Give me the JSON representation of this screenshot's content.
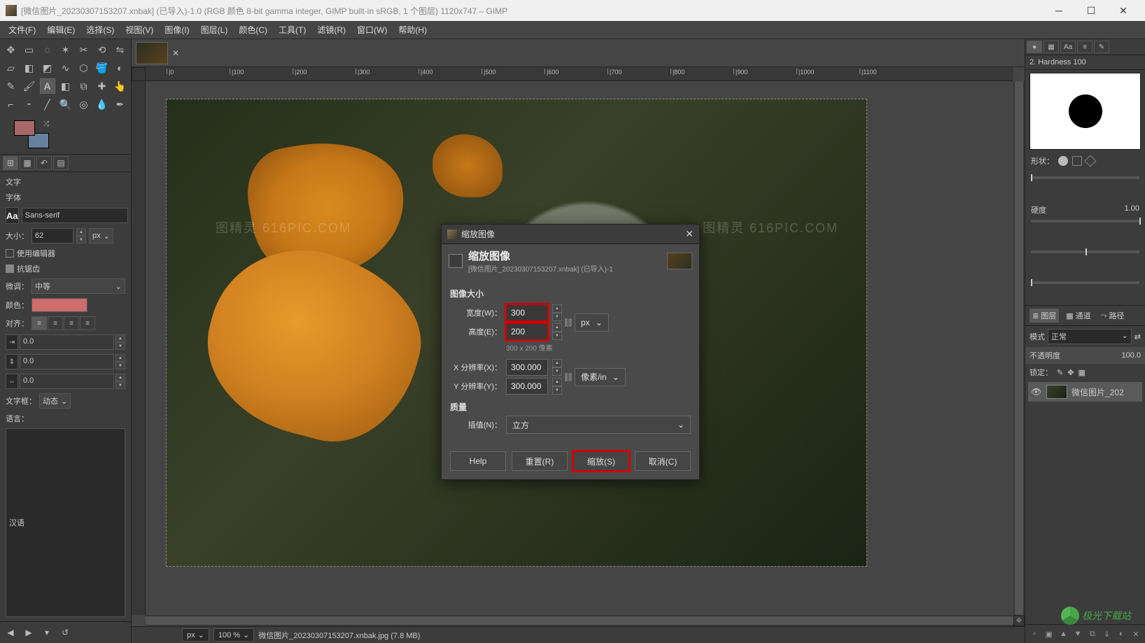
{
  "titlebar": {
    "text": "[微信图片_20230307153207.xnbak] (已导入)-1.0 (RGB 颜色 8-bit gamma integer, GIMP built-in sRGB, 1 个图层) 1120x747 – GIMP"
  },
  "menu": {
    "file": "文件(F)",
    "edit": "编辑(E)",
    "select": "选择(S)",
    "view": "视图(V)",
    "image": "图像(I)",
    "layer": "图层(L)",
    "colors": "颜色(C)",
    "tools": "工具(T)",
    "filters": "滤镜(R)",
    "windows": "窗口(W)",
    "help": "帮助(H)"
  },
  "text_tool": {
    "panel_label": "文字",
    "font_label": "字体",
    "font_value": "Sans-serif",
    "size_label": "大小：",
    "size_value": "62",
    "size_unit": "px",
    "use_editor": "使用编辑器",
    "antialias": "抗锯齿",
    "hinting_label": "微调：",
    "hinting_value": "中等",
    "color_label": "颜色：",
    "justify_label": "对齐：",
    "indent1": "0.0",
    "indent2": "0.0",
    "indent3": "0.0",
    "box_label": "文字框：",
    "box_value": "动态",
    "lang_label": "语言：",
    "lang_value": "汉语"
  },
  "statusbar": {
    "unit": "px",
    "zoom": "100 %",
    "filename": "微信图片_20230307153207.xnbak.jpg (7.8 MB)"
  },
  "ruler_marks": [
    "0",
    "100",
    "200",
    "300",
    "400",
    "500",
    "600",
    "700",
    "800",
    "900",
    "1000",
    "1100"
  ],
  "dialog": {
    "window_title": "缩放图像",
    "header": "缩放图像",
    "sub": "[微信图片_20230307153207.xnbak] (已导入)-1",
    "size_section": "图像大小",
    "width_label": "宽度(W)：",
    "width_value": "300",
    "height_label": "高度(E)：",
    "height_value": "200",
    "hint": "300 x 200 像素",
    "unit": "px",
    "xres_label": "X 分辨率(X)：",
    "xres_value": "300.000",
    "yres_label": "Y 分辨率(Y)：",
    "yres_value": "300.000",
    "res_unit": "像素/in",
    "quality_section": "质量",
    "interp_label": "插值(N)：",
    "interp_value": "立方",
    "help_btn": "Help",
    "reset_btn": "重置(R)",
    "scale_btn": "缩放(S)",
    "cancel_btn": "取消(C)"
  },
  "right": {
    "brush_title": "2. Hardness 100",
    "shape_label": "形状：",
    "hardness_label": "硬度",
    "hardness_value": "1.00",
    "layers_tab": "图层",
    "channels_tab": "通道",
    "paths_tab": "路径",
    "mode_label": "模式",
    "mode_value": "正常",
    "opacity_label": "不透明度",
    "opacity_value": "100.0",
    "lock_label": "锁定：",
    "layer_name": "微信图片_202"
  },
  "watermark": {
    "t1": "图精灵  616PIC.COM",
    "t2": "图精灵  616PIC.COM",
    "logo": "极光下载站"
  }
}
